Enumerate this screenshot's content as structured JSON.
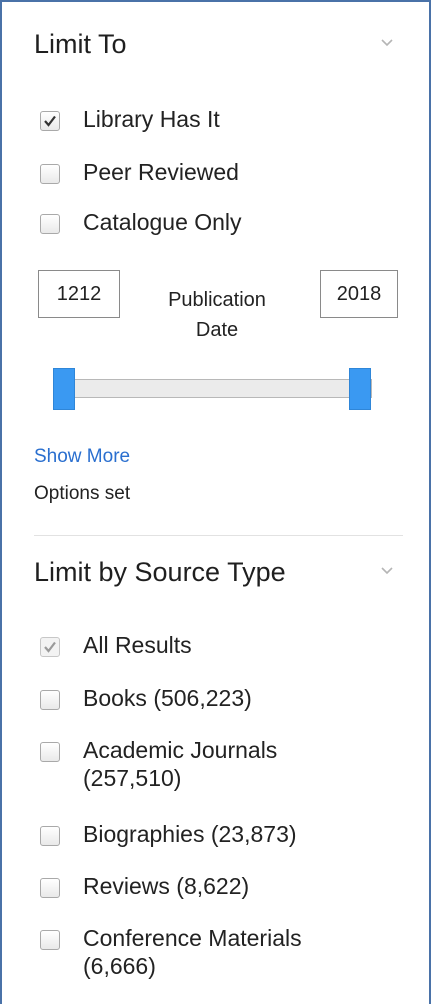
{
  "limit_to": {
    "title": "Limit To",
    "options": [
      {
        "label": "Library Has It",
        "checked": true
      },
      {
        "label": "Peer Reviewed",
        "checked": false
      },
      {
        "label": "Catalogue Only",
        "checked": false
      }
    ],
    "publication_date": {
      "label_line1": "Publication",
      "label_line2": "Date",
      "from": "1212",
      "to": "2018"
    },
    "show_more": "Show More",
    "status": "Options set"
  },
  "source_type": {
    "title": "Limit by Source Type",
    "options": [
      {
        "line1": "All Results",
        "line2": "",
        "checked": true,
        "disabled": true
      },
      {
        "line1": "Books (506,223)",
        "line2": "",
        "checked": false
      },
      {
        "line1": "Academic Journals",
        "line2": "(257,510)",
        "checked": false
      },
      {
        "line1": "Biographies (23,873)",
        "line2": "",
        "checked": false
      },
      {
        "line1": "Reviews (8,622)",
        "line2": "",
        "checked": false
      },
      {
        "line1": "Conference Materials",
        "line2": "(6,666)",
        "checked": false
      }
    ]
  },
  "colors": {
    "panel_border": "#4a72a8",
    "link": "#2a6fcf",
    "slider_handle": "#3a99f2"
  }
}
